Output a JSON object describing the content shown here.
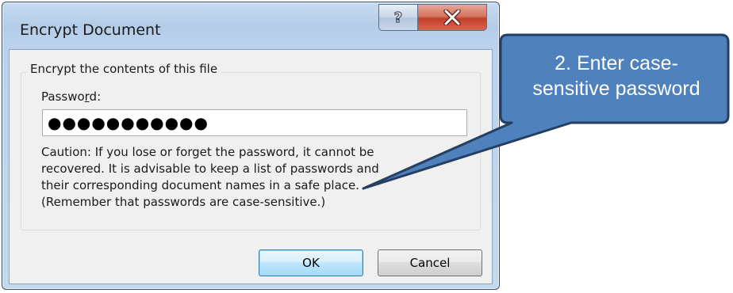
{
  "dialog": {
    "title": "Encrypt Document",
    "help_glyph": "?",
    "close_glyph": "X",
    "group_label": "Encrypt the contents of this file",
    "password_label_prefix": "Passwo",
    "password_label_accel": "r",
    "password_label_suffix": "d:",
    "password_masked": "●●●●●●●●●●●",
    "caution_lines": [
      "Caution: If you lose or forget the password, it cannot be",
      "recovered. It is advisable to keep a list of passwords and",
      "their corresponding document names in a safe place.",
      "(Remember that passwords are case-sensitive.)"
    ],
    "ok_label": "OK",
    "cancel_label": "Cancel"
  },
  "callout": {
    "line1": "2. Enter case-",
    "line2": "sensitive password",
    "fill_color": "#4f81bd",
    "stroke_color": "#243f60"
  },
  "icons": {
    "help": "question-mark",
    "close": "x-mark"
  }
}
